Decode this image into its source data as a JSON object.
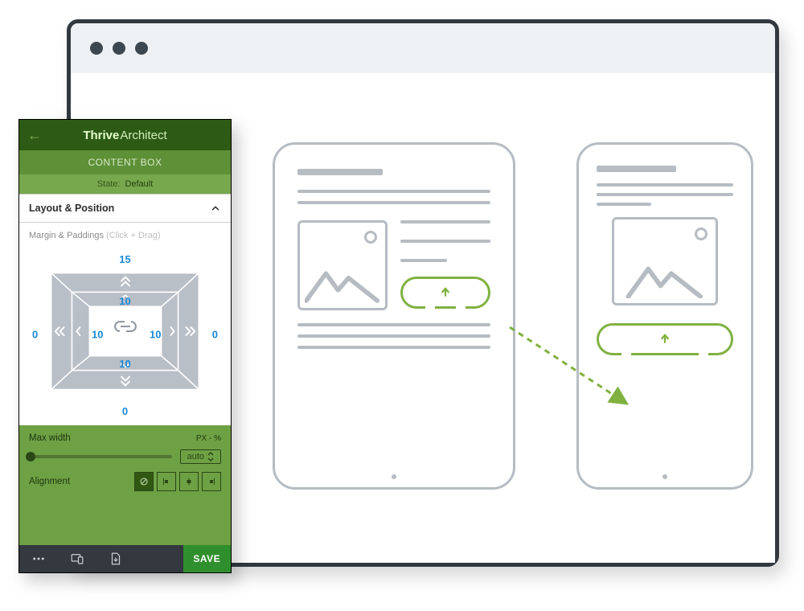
{
  "panel": {
    "brand_bold": "Thrive",
    "brand_light": "Architect",
    "element_label": "CONTENT BOX",
    "state_key": "State:",
    "state_value": "Default",
    "section_title": "Layout & Position",
    "margin_paddings_label": "Margin & Paddings",
    "margin_paddings_hint": "(Click + Drag)",
    "margin": {
      "top": "15",
      "right": "0",
      "bottom": "0",
      "left": "0"
    },
    "padding": {
      "top": "10",
      "right": "10",
      "bottom": "10",
      "left": "10"
    },
    "max_width_label": "Max width",
    "px_pc_label": "PX - %",
    "max_width_value": "auto",
    "alignment_label": "Alignment",
    "save_label": "SAVE"
  }
}
